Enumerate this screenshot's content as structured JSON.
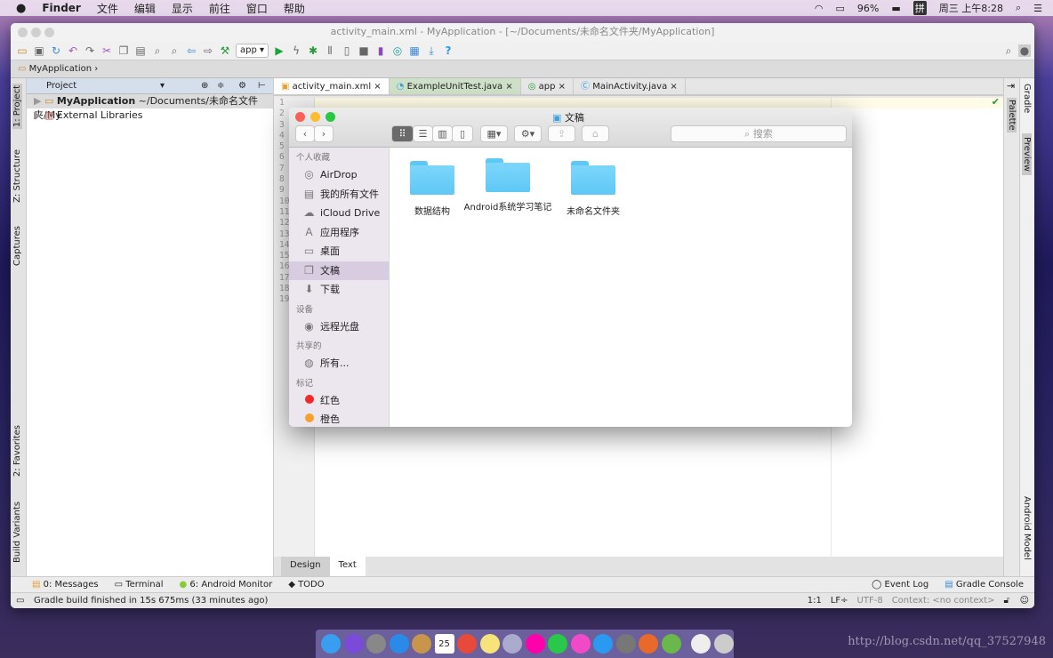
{
  "menubar": {
    "apple": "",
    "app": "Finder",
    "items": [
      "文件",
      "编辑",
      "显示",
      "前往",
      "窗口",
      "帮助"
    ],
    "battery": "96%",
    "ime": "拼",
    "clock": "周三 上午8:28"
  },
  "studio": {
    "title": "activity_main.xml - MyApplication - [~/Documents/未命名文件夹/MyApplication]",
    "run_config": "app",
    "breadcrumb": "MyApplication",
    "left_tools": [
      "1: Project",
      "Z: Structure",
      "Captures",
      "2: Favorites",
      "Build Variants"
    ],
    "project_panel": {
      "title": "Project",
      "tree": [
        {
          "name": "MyApplication",
          "path": "~/Documents/未命名文件夹/My"
        },
        {
          "name": "External Libraries"
        }
      ]
    },
    "tabs": [
      {
        "label": "activity_main.xml",
        "active": true
      },
      {
        "label": "ExampleUnitTest.java"
      },
      {
        "label": "app"
      },
      {
        "label": "MainActivity.java"
      }
    ],
    "line_numbers": [
      "1",
      "2",
      "3",
      "4",
      "5",
      "6",
      "7",
      "8",
      "9",
      "10",
      "11",
      "12",
      "13",
      "14",
      "15",
      "16",
      "17",
      "18",
      "19"
    ],
    "right_tools": [
      "Palette",
      "Gradle",
      "Preview",
      "Android Model"
    ],
    "design_tabs": [
      "Design",
      "Text"
    ],
    "tool_windows": [
      "0: Messages",
      "Terminal",
      "6: Android Monitor",
      "TODO"
    ],
    "tool_windows_right": [
      "Event Log",
      "Gradle Console"
    ],
    "status": {
      "message": "Gradle build finished in 15s 675ms (33 minutes ago)",
      "position": "1:1",
      "line_sep": "LF÷",
      "encoding": "UTF-8",
      "context": "Context: <no context>"
    }
  },
  "finder": {
    "title": "文稿",
    "search_placeholder": "搜索",
    "sections": [
      {
        "header": "个人收藏",
        "items": [
          {
            "label": "AirDrop",
            "icon": "airdrop-icon"
          },
          {
            "label": "我的所有文件",
            "icon": "all-files-icon"
          },
          {
            "label": "iCloud Drive",
            "icon": "cloud-icon"
          },
          {
            "label": "应用程序",
            "icon": "applications-icon"
          },
          {
            "label": "桌面",
            "icon": "desktop-icon"
          },
          {
            "label": "文稿",
            "icon": "documents-icon",
            "selected": true
          },
          {
            "label": "下载",
            "icon": "download-icon"
          }
        ]
      },
      {
        "header": "设备",
        "items": [
          {
            "label": "远程光盘",
            "icon": "disc-icon"
          }
        ]
      },
      {
        "header": "共享的",
        "items": [
          {
            "label": "所有...",
            "icon": "network-icon"
          }
        ]
      },
      {
        "header": "标记",
        "items": [
          {
            "label": "红色",
            "icon": "tag-red-icon",
            "color": "#f5282a"
          },
          {
            "label": "橙色",
            "icon": "tag-orange-icon",
            "color": "#f7a12c"
          }
        ]
      }
    ],
    "folders": [
      "数据结构",
      "Android系统学习笔记",
      "未命名文件夹"
    ]
  },
  "dock": {
    "calendar_day": "25"
  },
  "watermark": "http://blog.csdn.net/qq_37527948"
}
